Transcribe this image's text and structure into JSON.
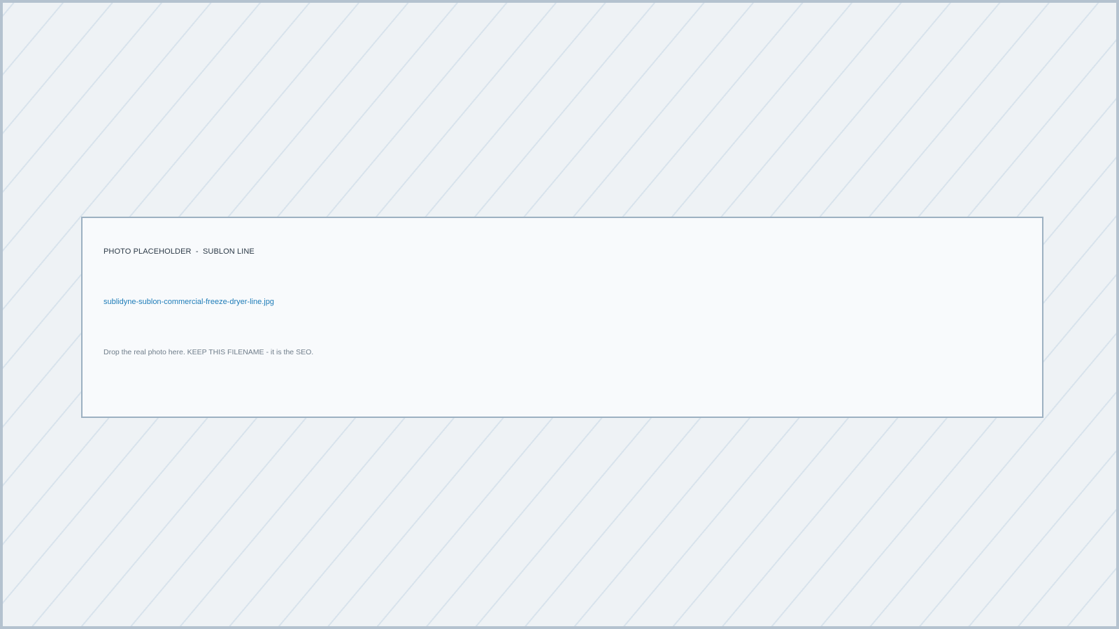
{
  "placeholder": {
    "label": "PHOTO PLACEHOLDER  -  SUBLON LINE",
    "filename": "sublidyne-sublon-commercial-freeze-dryer-line.jpg",
    "instruction": "Drop the real photo here. KEEP THIS FILENAME - it is the SEO."
  },
  "colors": {
    "background": "#eef2f5",
    "stripe": "#d8e3ec",
    "outer_border": "#b4c2cf",
    "card_border": "#9db1c2",
    "card_fill": "#f8fafc",
    "label_text": "#2c3a47",
    "filename_text": "#1e7cb8",
    "instruction_text": "#6f7d8a"
  }
}
